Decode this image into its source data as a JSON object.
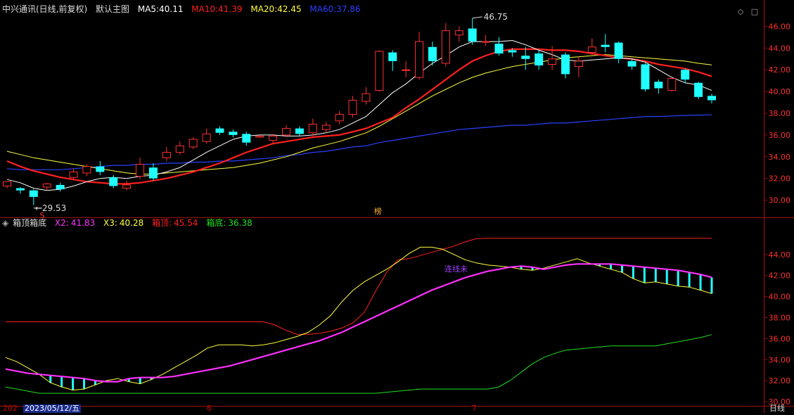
{
  "main_header": {
    "stock": "中兴通讯(日线,前复权)",
    "template": "默认主图",
    "ma": [
      {
        "label": "MA5:",
        "value": "40.11",
        "color": "#ffffff"
      },
      {
        "label": "MA10:",
        "value": "41.39",
        "color": "#ff2020"
      },
      {
        "label": "MA20:",
        "value": "42.45",
        "color": "#ffff40"
      },
      {
        "label": "MA60:",
        "value": "37.86",
        "color": "#2a40ff"
      }
    ]
  },
  "sub_header": {
    "indicator": "箱顶箱底",
    "items": [
      {
        "label": "X2:",
        "value": "41.83",
        "color": "#ff30ff"
      },
      {
        "label": "X3:",
        "value": "40.28",
        "color": "#ffff40"
      },
      {
        "label": "箱顶:",
        "value": "45.54",
        "color": "#ff2020"
      },
      {
        "label": "箱底:",
        "value": "36.38",
        "color": "#20e020"
      }
    ]
  },
  "icons": {
    "diamond": "◇",
    "maximize": "□"
  },
  "bottom": {
    "year_prefix": "202",
    "cursor_date": "2023/05/12/五",
    "month_6": "6",
    "month_7": "7",
    "period": "日线"
  },
  "colors": {
    "up": "#ff3030",
    "down": "#20ffff",
    "axis": "#a01010",
    "ma5": "#ffffff",
    "ma10": "#ff2020",
    "ma20": "#ffff40",
    "ma60": "#2a40ff",
    "x2": "#ff30ff",
    "top": "#ff2020",
    "bottom": "#20e020"
  },
  "chart_data": [
    {
      "type": "candlestick",
      "title": "",
      "ylim": [
        29,
        47
      ],
      "yticks": [
        "30.00",
        "32.00",
        "34.00",
        "36.00",
        "38.00",
        "40.00",
        "42.00",
        "44.00",
        "46.00"
      ],
      "annotations": [
        {
          "text": "46.75",
          "kind": "high"
        },
        {
          "text": "29.53",
          "kind": "low"
        },
        {
          "text": "S",
          "kind": "marker"
        },
        {
          "text": "榜",
          "kind": "marker"
        }
      ],
      "candles": [
        [
          31.3,
          31.7,
          31.1,
          31.7
        ],
        [
          31.1,
          30.9,
          30.6,
          31.2
        ],
        [
          30.9,
          30.3,
          29.53,
          31.0
        ],
        [
          31.2,
          31.5,
          30.9,
          31.6
        ],
        [
          31.4,
          31.0,
          30.8,
          31.6
        ],
        [
          32.1,
          32.6,
          31.9,
          32.9
        ],
        [
          32.5,
          33.1,
          32.2,
          33.3
        ],
        [
          33.1,
          32.6,
          32.3,
          33.6
        ],
        [
          32.1,
          31.3,
          31.1,
          32.3
        ],
        [
          31.1,
          31.4,
          30.9,
          31.8
        ],
        [
          32.2,
          33.3,
          31.9,
          33.9
        ],
        [
          33.0,
          32.0,
          31.8,
          33.4
        ],
        [
          33.9,
          34.4,
          33.6,
          34.9
        ],
        [
          34.4,
          35.0,
          34.2,
          35.4
        ],
        [
          34.9,
          35.6,
          34.7,
          35.8
        ],
        [
          35.4,
          36.1,
          35.2,
          36.6
        ],
        [
          36.6,
          36.2,
          36.0,
          36.8
        ],
        [
          36.3,
          36.0,
          35.8,
          36.5
        ],
        [
          36.1,
          35.3,
          35.0,
          36.3
        ],
        [
          35.8,
          35.9,
          35.7,
          35.9
        ],
        [
          35.5,
          35.9,
          35.2,
          36.1
        ],
        [
          36.0,
          36.6,
          35.8,
          36.9
        ],
        [
          36.6,
          36.1,
          35.9,
          36.8
        ],
        [
          36.2,
          37.0,
          35.9,
          37.5
        ],
        [
          36.5,
          36.9,
          36.2,
          37.2
        ],
        [
          37.3,
          37.9,
          37.0,
          38.2
        ],
        [
          37.9,
          39.2,
          37.6,
          39.6
        ],
        [
          39.1,
          39.8,
          38.8,
          40.4
        ],
        [
          40.1,
          43.7,
          40.0,
          43.8
        ],
        [
          43.6,
          42.8,
          41.9,
          43.8
        ],
        [
          42.0,
          42.0,
          41.3,
          42.8
        ],
        [
          41.3,
          44.6,
          41.1,
          45.5
        ],
        [
          44.1,
          42.8,
          42.4,
          44.6
        ],
        [
          42.6,
          45.6,
          42.3,
          46.3
        ],
        [
          45.2,
          45.6,
          44.6,
          46.0
        ],
        [
          45.8,
          44.6,
          44.3,
          46.75
        ],
        [
          44.6,
          44.6,
          44.2,
          45.2
        ],
        [
          44.4,
          43.5,
          43.3,
          45.0
        ],
        [
          43.8,
          43.6,
          43.2,
          44.0
        ],
        [
          43.3,
          43.0,
          42.0,
          44.1
        ],
        [
          43.5,
          42.4,
          42.0,
          43.8
        ],
        [
          42.5,
          43.0,
          42.0,
          44.2
        ],
        [
          43.4,
          41.6,
          41.2,
          43.6
        ],
        [
          42.3,
          42.8,
          41.3,
          43.2
        ],
        [
          43.6,
          44.1,
          43.4,
          44.9
        ],
        [
          44.3,
          44.1,
          43.6,
          45.3
        ],
        [
          44.5,
          43.0,
          42.6,
          44.6
        ],
        [
          42.8,
          42.3,
          42.0,
          43.0
        ],
        [
          42.5,
          40.2,
          40.0,
          42.6
        ],
        [
          40.9,
          40.3,
          39.8,
          41.1
        ],
        [
          40.1,
          41.2,
          40.0,
          41.4
        ],
        [
          42.0,
          41.1,
          40.8,
          42.1
        ],
        [
          40.8,
          39.5,
          39.3,
          40.9
        ],
        [
          39.6,
          39.2,
          38.9,
          39.8
        ]
      ],
      "ma5": [
        31.9,
        31.6,
        31.1,
        30.9,
        31.0,
        31.3,
        31.7,
        32.0,
        32.1,
        32.0,
        32.2,
        32.3,
        32.6,
        33.0,
        33.7,
        34.4,
        35.0,
        35.6,
        35.9,
        36.0,
        36.0,
        35.9,
        35.9,
        36.0,
        36.2,
        36.5,
        37.1,
        37.7,
        38.8,
        39.9,
        40.7,
        41.7,
        42.6,
        43.3,
        44.1,
        44.6,
        44.6,
        44.6,
        44.7,
        44.3,
        43.8,
        43.4,
        42.9,
        42.8,
        42.9,
        43.0,
        43.1,
        43.0,
        42.7,
        42.0,
        41.3,
        40.8,
        40.6,
        40.1
      ],
      "ma10": [
        33.6,
        33.1,
        32.7,
        32.4,
        32.1,
        31.9,
        31.7,
        31.6,
        31.5,
        31.5,
        31.6,
        31.8,
        32.0,
        32.3,
        32.6,
        33.0,
        33.4,
        33.9,
        34.4,
        34.8,
        35.2,
        35.4,
        35.6,
        35.8,
        35.9,
        36.0,
        36.3,
        36.6,
        37.1,
        37.6,
        38.5,
        39.3,
        40.2,
        41.1,
        42.0,
        42.8,
        43.3,
        43.7,
        43.9,
        43.9,
        43.9,
        43.8,
        43.8,
        43.7,
        43.5,
        43.3,
        43.1,
        43.0,
        42.8,
        42.5,
        42.3,
        42.1,
        41.8,
        41.39
      ],
      "ma20": [
        34.5,
        34.2,
        33.9,
        33.7,
        33.5,
        33.3,
        33.1,
        32.9,
        32.7,
        32.5,
        32.4,
        32.4,
        32.5,
        32.6,
        32.7,
        32.8,
        32.9,
        33.0,
        33.2,
        33.4,
        33.7,
        34.0,
        34.4,
        34.8,
        35.1,
        35.4,
        35.8,
        36.2,
        36.8,
        37.5,
        38.2,
        38.9,
        39.6,
        40.2,
        40.8,
        41.3,
        41.7,
        42.0,
        42.3,
        42.5,
        42.7,
        42.9,
        43.1,
        43.2,
        43.3,
        43.4,
        43.3,
        43.2,
        43.1,
        43.0,
        42.9,
        42.8,
        42.6,
        42.45
      ],
      "ma60": [
        32.9,
        32.8,
        32.8,
        32.8,
        32.8,
        32.9,
        33.0,
        33.1,
        33.2,
        33.2,
        33.3,
        33.3,
        33.4,
        33.4,
        33.5,
        33.5,
        33.6,
        33.6,
        33.7,
        33.8,
        33.9,
        34.1,
        34.2,
        34.4,
        34.5,
        34.7,
        34.9,
        35.0,
        35.3,
        35.5,
        35.7,
        35.9,
        36.1,
        36.3,
        36.5,
        36.6,
        36.7,
        36.8,
        36.9,
        36.9,
        37.0,
        37.1,
        37.1,
        37.2,
        37.3,
        37.4,
        37.5,
        37.6,
        37.7,
        37.7,
        37.75,
        37.8,
        37.83,
        37.86
      ]
    },
    {
      "type": "line",
      "title": "",
      "ylim": [
        29.6,
        46.8
      ],
      "yticks": [
        "30.00",
        "32.00",
        "34.00",
        "36.00",
        "38.00",
        "40.00",
        "42.00",
        "44.00"
      ],
      "annotations": [
        {
          "text": "连线未"
        }
      ],
      "x2": [
        33.1,
        32.9,
        32.7,
        32.6,
        32.5,
        32.4,
        32.3,
        32.2,
        32.0,
        31.9,
        31.9,
        32.2,
        32.3,
        32.3,
        32.3,
        32.4,
        32.6,
        32.8,
        33.0,
        33.2,
        33.4,
        33.7,
        34.0,
        34.3,
        34.6,
        34.9,
        35.2,
        35.5,
        35.8,
        36.2,
        36.6,
        37.1,
        37.6,
        38.1,
        38.6,
        39.1,
        39.6,
        40.1,
        40.6,
        41.0,
        41.4,
        41.8,
        42.1,
        42.4,
        42.6,
        42.8,
        42.9,
        42.8,
        42.6,
        42.8,
        43.0,
        43.1,
        43.1,
        43.1,
        43.1,
        43.0,
        42.9,
        42.8,
        42.7,
        42.6,
        42.5,
        42.3,
        42.1,
        41.83
      ],
      "x3": [
        34.2,
        33.8,
        33.2,
        32.6,
        31.8,
        31.4,
        31.1,
        31.2,
        31.6,
        32.0,
        32.2,
        31.9,
        31.7,
        32.1,
        32.6,
        33.2,
        33.8,
        34.4,
        35.1,
        35.4,
        35.4,
        35.4,
        35.3,
        35.4,
        35.6,
        35.9,
        36.2,
        36.6,
        37.3,
        38.2,
        39.5,
        40.6,
        41.4,
        42.0,
        42.6,
        43.3,
        44.1,
        44.7,
        44.7,
        44.5,
        44.0,
        43.5,
        43.2,
        43.0,
        42.9,
        42.8,
        42.6,
        42.5,
        42.7,
        43.0,
        43.3,
        43.6,
        43.2,
        42.9,
        42.6,
        42.3,
        41.7,
        41.3,
        41.4,
        41.2,
        41.0,
        40.9,
        40.6,
        40.28
      ],
      "top": [
        37.6,
        37.6,
        37.6,
        37.6,
        37.6,
        37.6,
        37.6,
        37.6,
        37.6,
        37.6,
        37.6,
        37.6,
        37.6,
        37.6,
        37.6,
        37.6,
        37.6,
        37.6,
        37.6,
        37.6,
        37.6,
        37.6,
        37.6,
        37.6,
        37.3,
        36.8,
        36.4,
        36.4,
        36.5,
        36.7,
        37.0,
        37.5,
        38.5,
        40.5,
        42.3,
        43.5,
        43.6,
        43.9,
        44.2,
        44.5,
        44.8,
        45.2,
        45.5,
        45.54,
        45.54,
        45.54,
        45.54,
        45.54,
        45.54,
        45.54,
        45.54,
        45.54,
        45.54,
        45.54,
        45.54,
        45.54,
        45.54,
        45.54,
        45.54,
        45.54,
        45.54,
        45.54,
        45.54,
        45.54
      ],
      "bottom": [
        31.4,
        31.2,
        31.0,
        30.8,
        30.8,
        30.8,
        30.8,
        30.8,
        30.8,
        30.8,
        30.8,
        30.8,
        30.8,
        30.8,
        30.8,
        30.8,
        30.8,
        30.8,
        30.8,
        30.8,
        30.8,
        30.8,
        30.8,
        30.8,
        30.8,
        30.8,
        30.8,
        30.8,
        30.8,
        30.8,
        30.8,
        30.8,
        30.8,
        30.8,
        30.9,
        31.0,
        31.1,
        31.2,
        31.2,
        31.2,
        31.2,
        31.2,
        31.2,
        31.2,
        31.4,
        32.0,
        32.8,
        33.6,
        34.2,
        34.6,
        34.9,
        35.0,
        35.1,
        35.2,
        35.3,
        35.3,
        35.3,
        35.3,
        35.3,
        35.5,
        35.7,
        35.9,
        36.1,
        36.38
      ]
    }
  ]
}
